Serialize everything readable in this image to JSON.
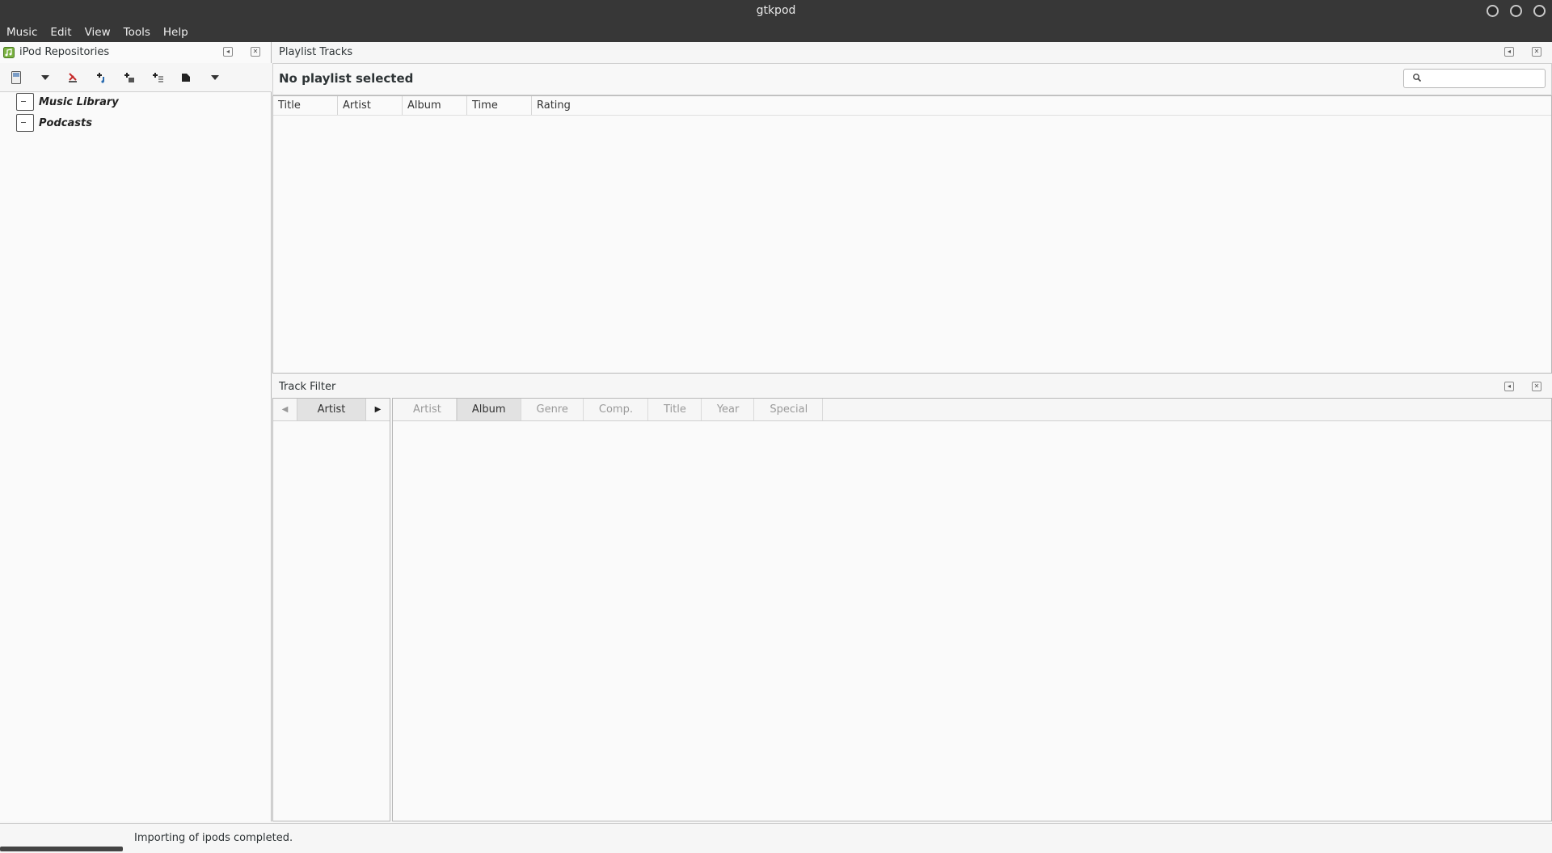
{
  "window": {
    "title": "gtkpod"
  },
  "menubar": {
    "items": [
      "Music",
      "Edit",
      "View",
      "Tools",
      "Help"
    ]
  },
  "left_pane": {
    "title": "iPod Repositories",
    "tree": [
      "Music Library",
      "Podcasts"
    ]
  },
  "playlist_pane": {
    "title": "Playlist Tracks",
    "heading": "No playlist selected",
    "search_value": "",
    "columns": [
      "Title",
      "Artist",
      "Album",
      "Time",
      "Rating"
    ]
  },
  "filter_pane": {
    "title": "Track Filter",
    "left_tab": "Artist",
    "tabs": [
      "Artist",
      "Album",
      "Genre",
      "Comp.",
      "Title",
      "Year",
      "Special"
    ],
    "active_tab": "Album"
  },
  "statusbar": {
    "message": "Importing of ipods completed."
  },
  "colors": {
    "titlebar": "#373737",
    "pane_bg": "#fafafa",
    "border": "#b8b8b8"
  }
}
